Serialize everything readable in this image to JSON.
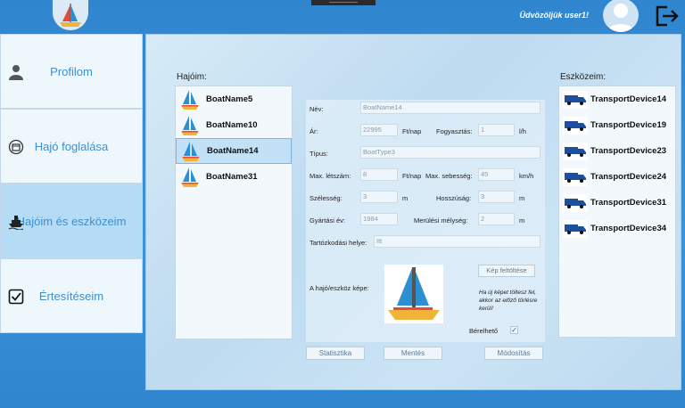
{
  "header": {
    "welcome": "Üdvözöljük user1!",
    "logo_icon": "sailboat-icon",
    "avatar_icon": "user-avatar-icon",
    "logout_icon": "logout-icon"
  },
  "sidebar": {
    "items": [
      {
        "label": "Profilom",
        "icon": "person-icon"
      },
      {
        "label": "Hajó foglalása",
        "icon": "calendar-icon"
      },
      {
        "label": "Hajóim és eszközeim",
        "icon": "ship-icon",
        "active": true
      },
      {
        "label": "Értesítéseim",
        "icon": "checkbox-icon"
      }
    ]
  },
  "boats": {
    "title": "Hajóim:",
    "items": [
      {
        "name": "BoatName5"
      },
      {
        "name": "BoatName10"
      },
      {
        "name": "BoatName14",
        "selected": true
      },
      {
        "name": "BoatName31"
      }
    ]
  },
  "devices": {
    "title": "Eszközeim:",
    "items": [
      {
        "name": "TransportDevice14"
      },
      {
        "name": "TransportDevice19"
      },
      {
        "name": "TransportDevice23"
      },
      {
        "name": "TransportDevice24"
      },
      {
        "name": "TransportDevice31"
      },
      {
        "name": "TransportDevice34"
      }
    ]
  },
  "form": {
    "name_label": "Név:",
    "name_value": "BoatName14",
    "price_label": "Ár:",
    "price_value": "22995",
    "price_unit": "Ft/nap",
    "consumption_label": "Fogyasztás:",
    "consumption_value": "1",
    "consumption_unit": "l/h",
    "type_label": "Típus:",
    "type_value": "BoatType3",
    "capacity_label": "Max. létszám:",
    "capacity_value": "8",
    "capacity_unit": "Ft/nap",
    "speed_label": "Max. sebesség:",
    "speed_value": "45",
    "speed_unit": "km/h",
    "width_label": "Szélesség:",
    "width_value": "3",
    "width_unit": "m",
    "length_label": "Hosszúság:",
    "length_value": "3",
    "length_unit": "m",
    "year_label": "Gyártási év:",
    "year_value": "1984",
    "depth_label": "Merülési mélység:",
    "depth_value": "2",
    "depth_unit": "m",
    "location_label": "Tartózkodási helye:",
    "location_value": "Itt",
    "image_label": "A hajó/eszköz képe:",
    "upload_button": "Kép feltöltése",
    "upload_note": "Ha új képet töltesz fel, akkor az előző törlésre kerül!",
    "rentable_label": "Bérelhető",
    "rentable_checked": "✓"
  },
  "actions": {
    "stats": "Statisztika",
    "save": "Mentés",
    "modify": "Módosítás"
  }
}
